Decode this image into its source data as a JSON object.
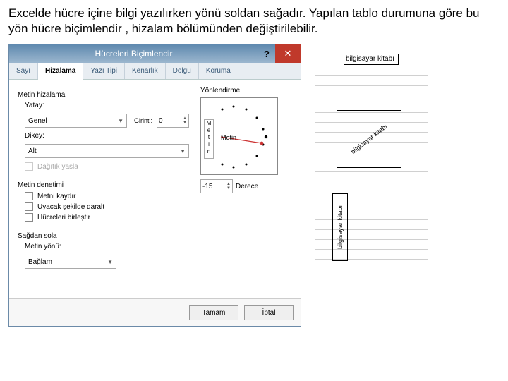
{
  "intro": "Excelde hücre içine bilgi yazılırken yönü soldan sağadır. Yapılan tablo durumuna göre bu yön hücre biçimlendir , hizalam bölümünden değiştirilebilir.",
  "dialog": {
    "title": "Hücreleri Biçimlendir",
    "tabs": [
      "Sayı",
      "Hizalama",
      "Yazı Tipi",
      "Kenarlık",
      "Dolgu",
      "Koruma"
    ],
    "active_tab": 1,
    "sections": {
      "text_align": "Metin hizalama",
      "horizontal_label": "Yatay:",
      "horizontal_value": "Genel",
      "indent_label": "Girinti:",
      "indent_value": "0",
      "vertical_label": "Dikey:",
      "vertical_value": "Alt",
      "justify_distributed": "Dağıtık yasla",
      "text_control": "Metin denetimi",
      "wrap": "Metni kaydır",
      "shrink": "Uyacak şekilde daralt",
      "merge": "Hücreleri birleştir",
      "rtl": "Sağdan sola",
      "dir_label": "Metin yönü:",
      "dir_value": "Bağlam",
      "orient": "Yönlendirme",
      "orient_vword": "Metin",
      "orient_arc_word": "Metin",
      "deg_value": "-15",
      "deg_label": "Derece"
    },
    "buttons": {
      "ok": "Tamam",
      "cancel": "İptal"
    }
  },
  "examples": {
    "e1": "bilgisayar kitabı",
    "e2": "bilgisayar kitabı",
    "e3": "bilgisayar kitabı"
  }
}
